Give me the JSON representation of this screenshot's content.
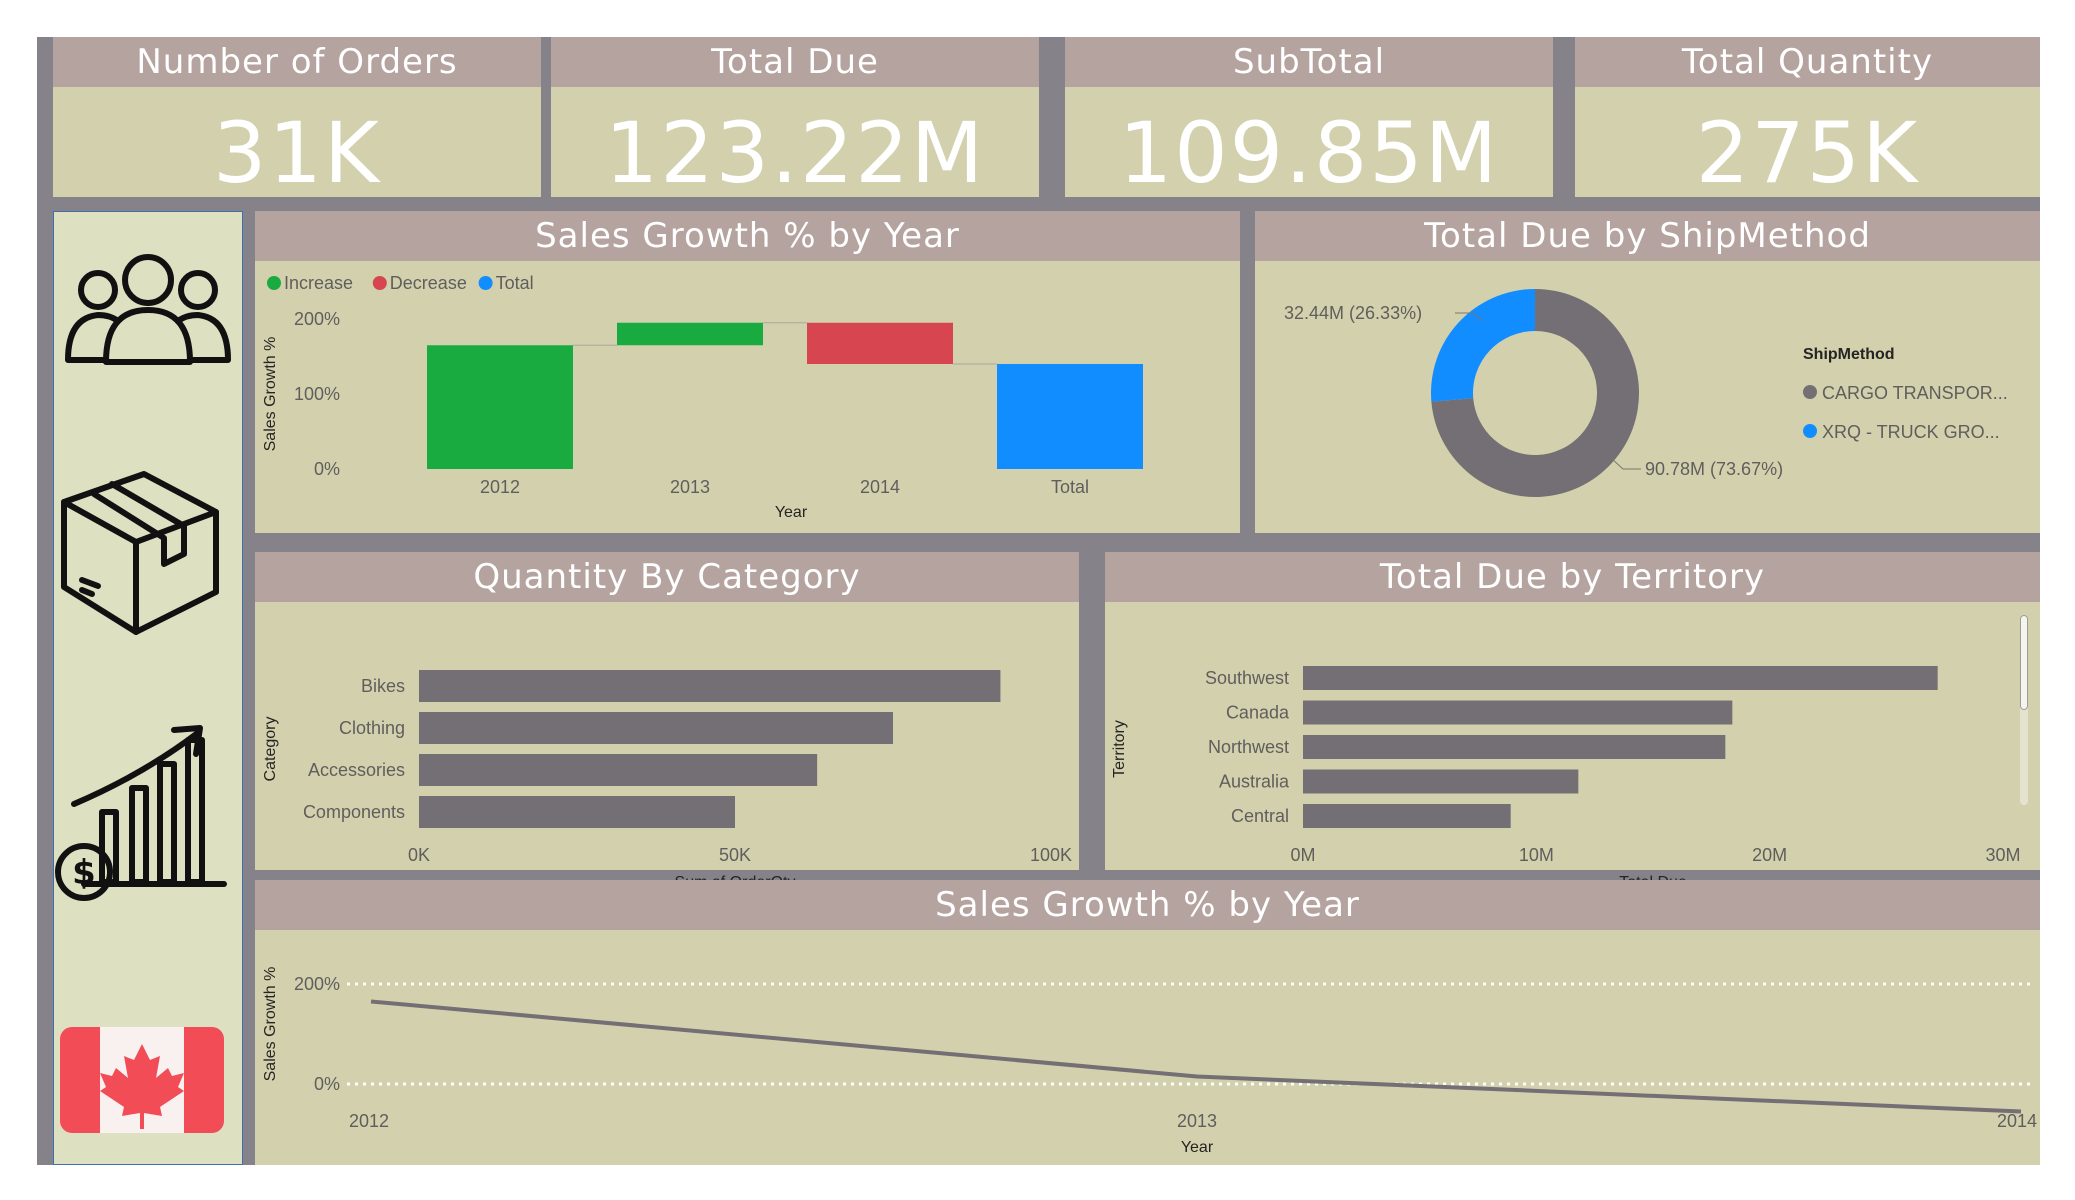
{
  "kpis": [
    {
      "title": "Number of Orders",
      "value": "31K"
    },
    {
      "title": "Total Due",
      "value": "123.22M"
    },
    {
      "title": "SubTotal",
      "value": "109.85M"
    },
    {
      "title": "Total Quantity",
      "value": "275K"
    }
  ],
  "sidebar": {
    "icons": [
      "people-group-icon",
      "package-box-icon",
      "sales-growth-icon",
      "canada-flag-icon"
    ]
  },
  "panels": {
    "growth_waterfall": {
      "title": "Sales Growth % by Year"
    },
    "shipmethod_donut": {
      "title": "Total Due by ShipMethod"
    },
    "category_bar": {
      "title": "Quantity By Category"
    },
    "territory_bar": {
      "title": "Total Due by Territory"
    },
    "growth_line": {
      "title": "Sales Growth % by Year"
    }
  },
  "colors": {
    "panel_bg": "#d3d1ad",
    "header_bg": "#b5a39f",
    "bar_gray": "#736f74",
    "increase": "#1aab40",
    "decrease": "#d64550",
    "total": "#118dff"
  },
  "chart_data": [
    {
      "type": "bar",
      "subtype": "waterfall",
      "title": "Sales Growth % by Year",
      "legend": [
        "Increase",
        "Decrease",
        "Total"
      ],
      "legend_colors": [
        "#1aab40",
        "#d64550",
        "#118dff"
      ],
      "categories": [
        "2012",
        "2013",
        "2014",
        "Total"
      ],
      "values": [
        165,
        30,
        -55,
        140
      ],
      "kinds": [
        "increase",
        "increase",
        "decrease",
        "total"
      ],
      "xlabel": "Year",
      "ylabel": "Sales Growth %",
      "yticks": [
        "0%",
        "100%",
        "200%"
      ],
      "ylim": [
        0,
        200
      ]
    },
    {
      "type": "pie",
      "subtype": "donut",
      "title": "Total Due by ShipMethod",
      "legend_title": "ShipMethod",
      "labels": [
        "CARGO TRANSPOR...",
        "XRQ - TRUCK GRO..."
      ],
      "values": [
        90.78,
        32.44
      ],
      "data_labels": [
        "90.78M (73.67%)",
        "32.44M (26.33%)"
      ],
      "colors": [
        "#736f74",
        "#118dff"
      ]
    },
    {
      "type": "bar",
      "orientation": "horizontal",
      "title": "Quantity By Category",
      "categories": [
        "Bikes",
        "Clothing",
        "Accessories",
        "Components"
      ],
      "values": [
        92000,
        75000,
        63000,
        50000
      ],
      "xlabel": "Sum of OrderQty",
      "ylabel": "Category",
      "xticks": [
        "0K",
        "50K",
        "100K"
      ],
      "xlim": [
        0,
        100000
      ]
    },
    {
      "type": "bar",
      "orientation": "horizontal",
      "title": "Total Due by Territory",
      "categories": [
        "Southwest",
        "Canada",
        "Northwest",
        "Australia",
        "Central"
      ],
      "values": [
        27200000,
        18400000,
        18100000,
        11800000,
        8900000
      ],
      "xlabel": "Total Due",
      "ylabel": "Territory",
      "xticks": [
        "0M",
        "10M",
        "20M",
        "30M"
      ],
      "xlim": [
        0,
        30000000
      ]
    },
    {
      "type": "line",
      "title": "Sales Growth % by Year",
      "x": [
        "2012",
        "2013",
        "2014"
      ],
      "values": [
        165,
        15,
        -55
      ],
      "xlabel": "Year",
      "ylabel": "Sales Growth %",
      "yticks": [
        "0%",
        "200%"
      ],
      "ylim": [
        -80,
        200
      ],
      "grid": "dotted"
    }
  ]
}
